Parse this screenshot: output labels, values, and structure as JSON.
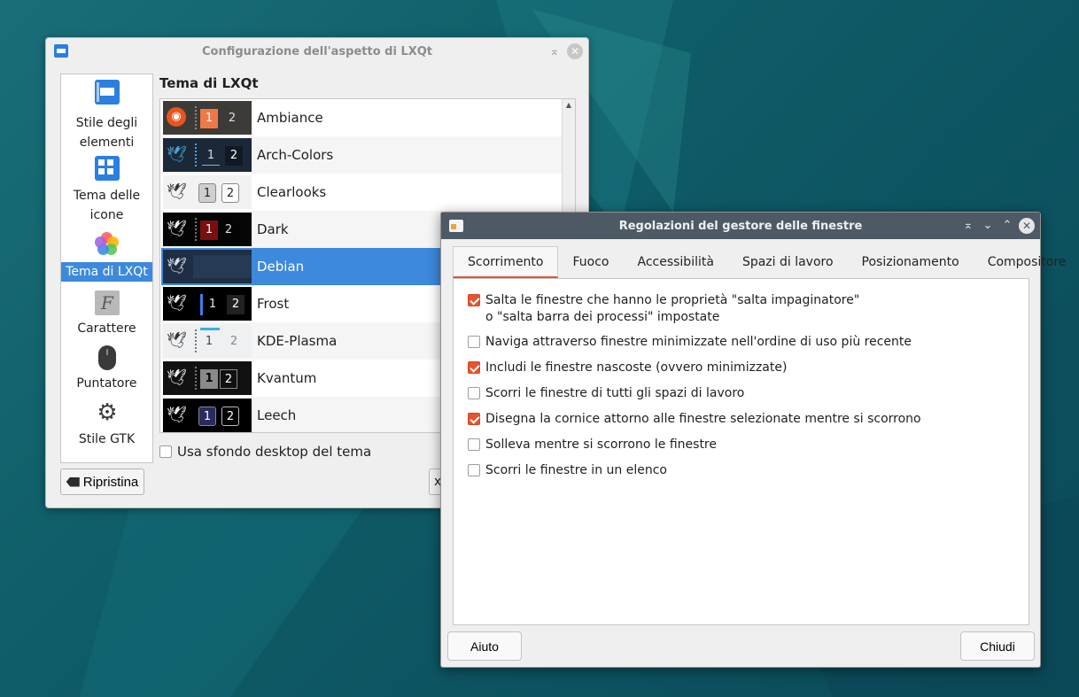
{
  "appearance": {
    "title": "Configurazione dell'aspetto di LXQt",
    "sidebar": [
      {
        "label": "Stile degli elementi",
        "icon": "window-style-icon"
      },
      {
        "label": "Tema delle icone",
        "icon": "icon-theme-icon"
      },
      {
        "label": "Tema di LXQt",
        "icon": "lxqt-theme-icon"
      },
      {
        "label": "Carattere",
        "icon": "font-icon"
      },
      {
        "label": "Puntatore",
        "icon": "mouse-icon"
      },
      {
        "label": "Stile GTK",
        "icon": "gear-icon"
      }
    ],
    "selected_sidebar": "Tema di LXQt",
    "heading": "Tema di LXQt",
    "themes": [
      {
        "name": "Ambiance",
        "n1": "1",
        "n2": "2"
      },
      {
        "name": "Arch-Colors",
        "n1": "1",
        "n2": "2"
      },
      {
        "name": "Clearlooks",
        "n1": "1",
        "n2": "2"
      },
      {
        "name": "Dark",
        "n1": "1",
        "n2": "2"
      },
      {
        "name": "Debian",
        "n1": "",
        "n2": ""
      },
      {
        "name": "Frost",
        "n1": "1",
        "n2": "2"
      },
      {
        "name": "KDE-Plasma",
        "n1": "1",
        "n2": "2"
      },
      {
        "name": "Kvantum",
        "n1": "1",
        "n2": "2"
      },
      {
        "name": "Leech",
        "n1": "1",
        "n2": "2"
      }
    ],
    "selected_theme": "Debian",
    "wallpaper_checkbox": "Usa sfondo desktop del tema",
    "reset_button": "Ripristina",
    "partial_button": "x"
  },
  "wm": {
    "title": "Regolazioni del gestore delle finestre",
    "tabs": [
      "Scorrimento",
      "Fuoco",
      "Accessibilità",
      "Spazi di lavoro",
      "Posizionamento",
      "Compositore"
    ],
    "active_tab": "Scorrimento",
    "options": [
      {
        "line1": "Salta le finestre che hanno le proprietà \"salta impaginatore\"",
        "line2": "o \"salta barra dei processi\" impostate",
        "checked": true
      },
      {
        "line1": "Naviga attraverso finestre minimizzate nell'ordine di uso più recente",
        "line2": "",
        "checked": false
      },
      {
        "line1": "Includi le finestre nascoste (ovvero minimizzate)",
        "line2": "",
        "checked": true
      },
      {
        "line1": "Scorri le finestre di tutti gli spazi di lavoro",
        "line2": "",
        "checked": false
      },
      {
        "line1": "Disegna la cornice attorno alle finestre selezionate mentre si scorrono",
        "line2": "",
        "checked": true
      },
      {
        "line1": "Solleva mentre si scorrono le finestre",
        "line2": "",
        "checked": false
      },
      {
        "line1": "Scorri le finestre in un elenco",
        "line2": "",
        "checked": false
      }
    ],
    "help_button": "Aiuto",
    "close_button": "Chiudi"
  },
  "colors": {
    "accent": "#e5552e",
    "selection": "#3d89dd",
    "wm_titlebar": "#4d5a66"
  }
}
